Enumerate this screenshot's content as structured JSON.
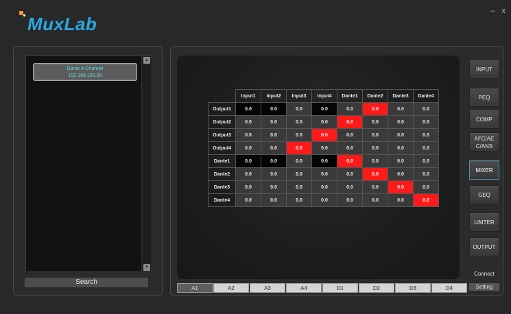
{
  "app": {
    "brand": "MuxLab",
    "minimize": "–",
    "close": "x"
  },
  "device_list": {
    "items": [
      {
        "name": "Dante 4-Channel",
        "ip": "192.168.168.99"
      }
    ],
    "search_label": "Search"
  },
  "matrix": {
    "columns": [
      "Input1",
      "Input2",
      "Input3",
      "Input4",
      "Dante1",
      "Dante2",
      "Dante3",
      "Dante4"
    ],
    "rows": [
      {
        "label": "Output1",
        "values": [
          "0.0",
          "0.0",
          "0.0",
          "0.0",
          "0.0",
          "0.0",
          "0.0",
          "0.0"
        ],
        "states": [
          "blk",
          "blk",
          "",
          "blk",
          "",
          "on",
          "",
          ""
        ]
      },
      {
        "label": "Output2",
        "values": [
          "0.0",
          "0.0",
          "0.0",
          "0.0",
          "0.0",
          "0.0",
          "0.0",
          "0.0"
        ],
        "states": [
          "",
          "",
          "",
          "",
          "on",
          "",
          "",
          ""
        ]
      },
      {
        "label": "Output3",
        "values": [
          "0.0",
          "0.0",
          "0.0",
          "0.0",
          "0.0",
          "0.0",
          "0.0",
          "0.0"
        ],
        "states": [
          "",
          "",
          "",
          "on",
          "",
          "",
          "",
          ""
        ]
      },
      {
        "label": "Output4",
        "values": [
          "0.0",
          "0.0",
          "0.0",
          "0.0",
          "0.0",
          "0.0",
          "0.0",
          "0.0"
        ],
        "states": [
          "",
          "",
          "on",
          "",
          "",
          "",
          "",
          ""
        ]
      },
      {
        "label": "Dante1",
        "values": [
          "0.0",
          "0.0",
          "0.0",
          "0.0",
          "0.0",
          "0.0",
          "0.0",
          "0.0"
        ],
        "states": [
          "blk",
          "blk",
          "",
          "blk",
          "on",
          "",
          "",
          ""
        ]
      },
      {
        "label": "Dante2",
        "values": [
          "0.0",
          "0.0",
          "0.0",
          "0.0",
          "0.0",
          "0.0",
          "0.0",
          "0.0"
        ],
        "states": [
          "",
          "",
          "",
          "",
          "",
          "on",
          "",
          ""
        ]
      },
      {
        "label": "Dante3",
        "values": [
          "0.0",
          "0.0",
          "0.0",
          "0.0",
          "0.0",
          "0.0",
          "0.0",
          "0.0"
        ],
        "states": [
          "",
          "",
          "",
          "",
          "",
          "",
          "on",
          ""
        ]
      },
      {
        "label": "Dante4",
        "values": [
          "0.0",
          "0.0",
          "0.0",
          "0.0",
          "0.0",
          "0.0",
          "0.0",
          "0.0"
        ],
        "states": [
          "",
          "",
          "",
          "",
          "",
          "",
          "",
          "on"
        ]
      }
    ]
  },
  "tabs": [
    "A1",
    "A2",
    "A3",
    "A4",
    "D1",
    "D2",
    "D3",
    "D4"
  ],
  "active_tab": "A1",
  "side_buttons": [
    {
      "label": "INPUT"
    },
    {
      "label": "PEQ"
    },
    {
      "label": "COMP"
    },
    {
      "label": "AFC/AE C/ANS",
      "line1": "AFC/AE",
      "line2": "C/ANS"
    },
    {
      "label": "MIXER",
      "active": true
    },
    {
      "label": "GEQ"
    },
    {
      "label": "LIMTER"
    },
    {
      "label": "OUTPUT"
    }
  ],
  "connect": {
    "line1": "Connect",
    "line2": "Setting"
  },
  "colors": {
    "accent": "#2aa8e0",
    "active_cell": "#ff1a1a",
    "device_text": "#5bdde0"
  }
}
